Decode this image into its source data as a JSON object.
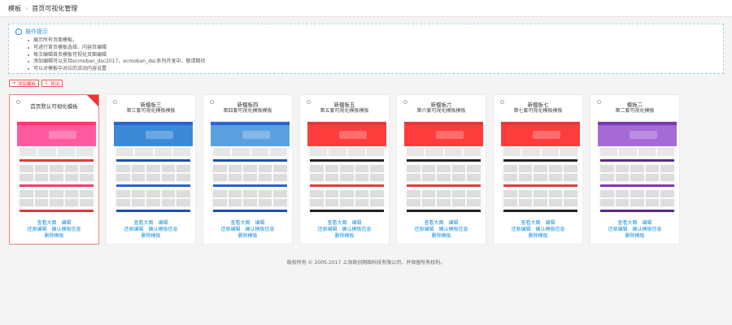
{
  "breadcrumb": {
    "root": "模板",
    "current": "首页可视化管理"
  },
  "tips": {
    "title": "操作提示",
    "items": [
      "展示所有页面模板。",
      "可进行首页模板选择、内容页编辑",
      "每次编辑首页模板可视化页面编辑",
      "添加编辑可以支持ecmoban_dsc2017，ecmoban_dsc系列开发中，敬请期待",
      "可以对模板中对应的活动内容设置"
    ]
  },
  "actions": {
    "add_label": "添加模板",
    "export_label": "导出"
  },
  "cards": [
    {
      "name": "首页默认可视化模板",
      "desc": "",
      "selected": true,
      "color": "#e4393c",
      "nav": "#ff3b6b",
      "banner": "#ff5aa0"
    },
    {
      "name": "新模板三",
      "desc": "第三套可视化模板模板",
      "selected": false,
      "color": "#1e4fb5",
      "nav": "#2a62d4",
      "banner": "#3a8ad8"
    },
    {
      "name": "新模板四",
      "desc": "第四套可视化模板模板",
      "selected": false,
      "color": "#1e4fb5",
      "nav": "#2a62d4",
      "banner": "#5aa0e0"
    },
    {
      "name": "新模板五",
      "desc": "第五套可视化模板模板",
      "selected": false,
      "color": "#222222",
      "nav": "#e4393c",
      "banner": "#ff3c3c"
    },
    {
      "name": "新模板六",
      "desc": "第六套可视化模板模板",
      "selected": false,
      "color": "#222222",
      "nav": "#e4393c",
      "banner": "#ff3c3c"
    },
    {
      "name": "新模板七",
      "desc": "第七套可视化模板模板",
      "selected": false,
      "color": "#222222",
      "nav": "#e4393c",
      "banner": "#ff3c3c"
    },
    {
      "name": "模板二",
      "desc": "第二套可视化模板",
      "selected": false,
      "color": "#5a2a8a",
      "nav": "#7a3ab0",
      "banner": "#a56ad6"
    }
  ],
  "card_links": {
    "view_large": "查看大图",
    "edit": "编辑",
    "restore": "还原编辑",
    "confirm": "确认模板信息",
    "delete": "删除模板"
  },
  "footer": "版权所有 © 2005-2017 上海商创网络科技有限公司，并保留所有权利。"
}
